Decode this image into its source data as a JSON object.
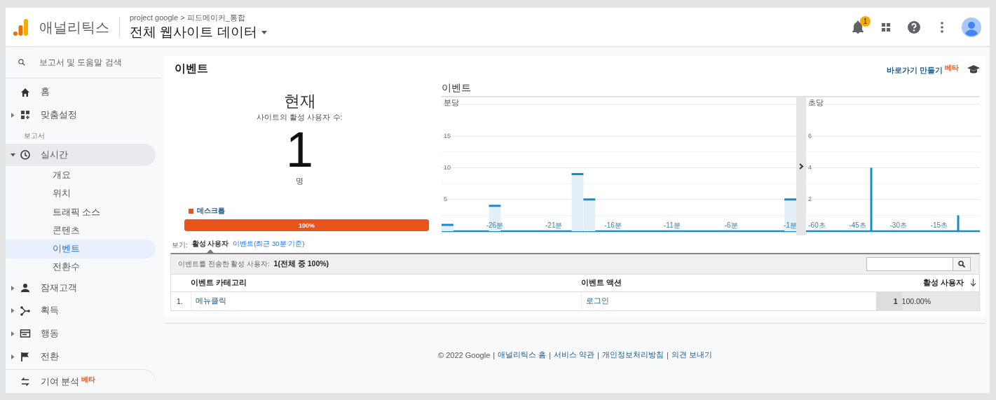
{
  "header": {
    "product": "애널리틱스",
    "breadcrumb": "project google > 피드메이커_통합",
    "view_title": "전체 웹사이트 데이터",
    "notification_count": "1"
  },
  "sidebar": {
    "search": {
      "placeholder": "보고서 및 도움말 검색"
    },
    "items": [
      {
        "kind": "link",
        "label": "홈"
      },
      {
        "kind": "group",
        "label": "맞춤설정",
        "expanded": false
      },
      {
        "kind": "heading",
        "label": "보고서"
      },
      {
        "kind": "group",
        "label": "실시간",
        "expanded": true,
        "children": [
          {
            "label": "개요",
            "selected": false
          },
          {
            "label": "위치",
            "selected": false
          },
          {
            "label": "트래픽 소스",
            "selected": false
          },
          {
            "label": "콘텐츠",
            "selected": false
          },
          {
            "label": "이벤트",
            "selected": true
          },
          {
            "label": "전환수",
            "selected": false
          }
        ]
      },
      {
        "kind": "group",
        "label": "잠재고객",
        "expanded": false
      },
      {
        "kind": "group",
        "label": "획득",
        "expanded": false
      },
      {
        "kind": "group",
        "label": "행동",
        "expanded": false
      },
      {
        "kind": "group",
        "label": "전환",
        "expanded": false
      },
      {
        "kind": "link",
        "label": "기여 분석",
        "badge": "베타"
      }
    ]
  },
  "page": {
    "title": "이벤트",
    "shortcut": {
      "label": "바로가기 만들기",
      "badge": "베타"
    }
  },
  "summary": {
    "heading": "현재",
    "subtitle": "사이트의 활성 사용자 수:",
    "count": "1",
    "unit": "명",
    "legend": "데스크톱",
    "bar": {
      "level": 1,
      "label": "100%"
    }
  },
  "charts_title": "이벤트",
  "per_minute": {
    "label": "분당",
    "chart_data": {
      "type": "bar",
      "x": [
        -30,
        -29,
        -28,
        -27,
        -26,
        -25,
        -24,
        -23,
        -22,
        -21,
        -20,
        -19,
        -18,
        -17,
        -16,
        -15,
        -14,
        -13,
        -12,
        -11,
        -10,
        -9,
        -8,
        -7,
        -6,
        -5,
        -4,
        -3,
        -2,
        -1
      ],
      "values": [
        1,
        0,
        0,
        0,
        4,
        0,
        0,
        0,
        0,
        0,
        0,
        9,
        5,
        0,
        0,
        0,
        0,
        0,
        0,
        0,
        0,
        0,
        0,
        0,
        0,
        0,
        0,
        0,
        0,
        5
      ],
      "xlim": [
        -30.5,
        -0.5
      ],
      "ylim": [
        0,
        20
      ],
      "grid": true,
      "yticks": [
        5,
        10,
        15
      ],
      "xticks": [
        {
          "value": -26,
          "label": "-26분"
        },
        {
          "value": -21,
          "label": "-21분"
        },
        {
          "value": -16,
          "label": "-16분"
        },
        {
          "value": -11,
          "label": "-11분"
        },
        {
          "value": -6,
          "label": "-6분"
        },
        {
          "value": -1,
          "label": "-1분"
        }
      ]
    }
  },
  "per_second": {
    "label": "초당",
    "chart_data": {
      "type": "bar",
      "x": [
        -40,
        -8
      ],
      "values": [
        4,
        1
      ],
      "xlim": [
        -64,
        0
      ],
      "ylim": [
        0,
        8
      ],
      "grid": true,
      "yticks": [
        2,
        4,
        6
      ],
      "xticks": [
        {
          "value": -60,
          "label": "-60초"
        },
        {
          "value": -45,
          "label": "-45초"
        },
        {
          "value": -30,
          "label": "-30초"
        },
        {
          "value": -15,
          "label": "-15초"
        }
      ]
    }
  },
  "table_view": {
    "prefix": "보기:",
    "tabs": [
      {
        "label": "활성 사용자",
        "selected": true
      },
      {
        "label": "이벤트(최근 30분 기준)",
        "selected": false
      }
    ]
  },
  "table_summary": {
    "label": "이벤트를 전송한 활성 사용자:",
    "value": "1(전체 중 100%)"
  },
  "table": {
    "columns": [
      "이벤트 카테고리",
      "이벤트 액션",
      "활성 사용자"
    ],
    "rows": [
      {
        "index": "1.",
        "category": "메뉴클릭",
        "action": "로그인",
        "users": "1",
        "share": "100.00%"
      }
    ]
  },
  "footer": [
    {
      "kind": "text",
      "text": "© 2022 Google"
    },
    {
      "kind": "sep",
      "text": "|"
    },
    {
      "kind": "link",
      "text": "애널리틱스 홈"
    },
    {
      "kind": "sep",
      "text": "|"
    },
    {
      "kind": "link",
      "text": "서비스 약관"
    },
    {
      "kind": "sep",
      "text": "|"
    },
    {
      "kind": "link",
      "text": "개인정보처리방침"
    },
    {
      "kind": "sep",
      "text": "|"
    },
    {
      "kind": "link",
      "text": "의견 보내기"
    }
  ]
}
